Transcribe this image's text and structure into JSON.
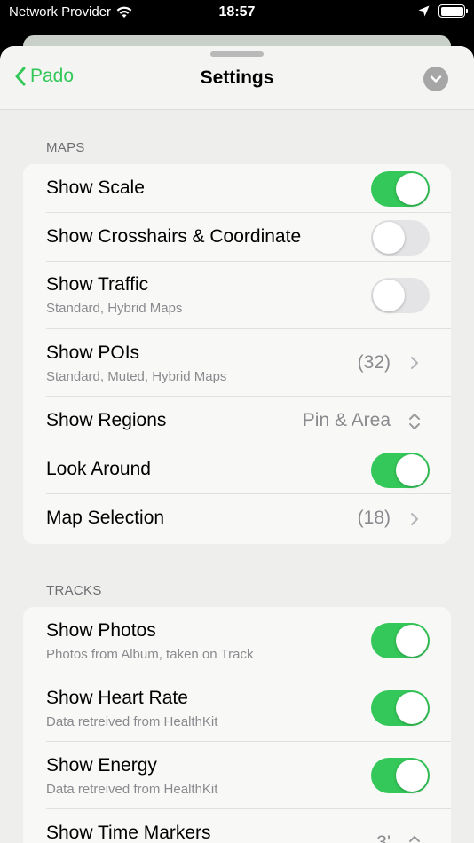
{
  "status_bar": {
    "carrier": "Network Provider",
    "time": "18:57",
    "battery_level": 1.0
  },
  "nav": {
    "back_label": "Pado",
    "title": "Settings"
  },
  "icons": {
    "back": "chevron-left-icon",
    "close": "chevron-down-icon",
    "wifi": "wifi-icon",
    "location": "location-arrow-icon",
    "battery": "battery-icon"
  },
  "colors": {
    "accent": "#34c759",
    "toggle_off": "#e4e4e6",
    "secondary_text": "#8a8a8e"
  },
  "maps": {
    "header": "MAPS",
    "rows": [
      {
        "title": "Show Scale",
        "toggle": true
      },
      {
        "title": "Show Crosshairs & Coordinate",
        "toggle": false
      },
      {
        "title": "Show Traffic",
        "subtitle": "Standard, Hybrid Maps",
        "toggle": false
      },
      {
        "title": "Show POIs",
        "subtitle": "Standard, Muted, Hybrid Maps",
        "value": "(32)"
      },
      {
        "title": "Show Regions",
        "value": "Pin & Area"
      },
      {
        "title": "Look Around",
        "toggle": true
      },
      {
        "title": "Map Selection",
        "value": "(18)"
      }
    ]
  },
  "tracks": {
    "header": "TRACKS",
    "rows": [
      {
        "title": "Show Photos",
        "subtitle": "Photos from Album, taken on Track",
        "toggle": true
      },
      {
        "title": "Show Heart Rate",
        "subtitle": "Data retreived from HealthKit",
        "toggle": true
      },
      {
        "title": "Show Energy",
        "subtitle": "Data retreived from HealthKit",
        "toggle": true
      },
      {
        "title": "Show Time Markers",
        "value": "3'"
      }
    ]
  }
}
